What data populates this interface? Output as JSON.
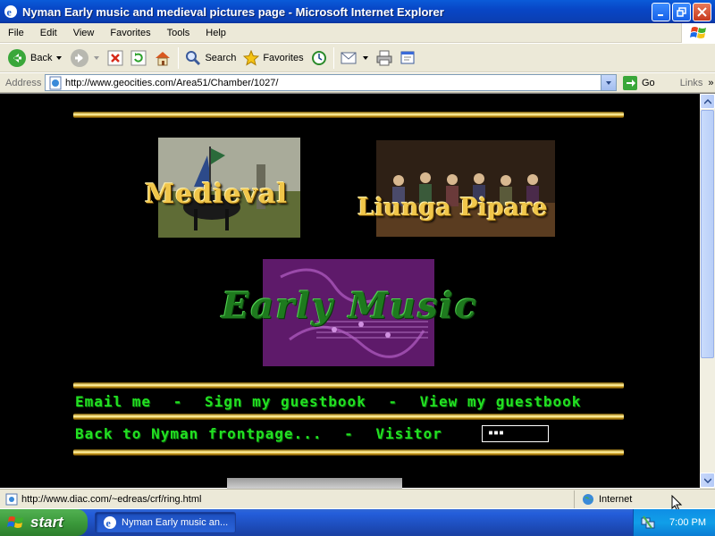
{
  "window": {
    "title": "Nyman Early music and medieval pictures page - Microsoft Internet Explorer"
  },
  "menu": [
    "File",
    "Edit",
    "View",
    "Favorites",
    "Tools",
    "Help"
  ],
  "toolbar": {
    "back_label": "Back",
    "search_label": "Search",
    "favorites_label": "Favorites"
  },
  "address": {
    "label": "Address",
    "url": "http://www.geocities.com/Area51/Chamber/1027/",
    "go_label": "Go",
    "links_label": "Links"
  },
  "page": {
    "medieval_title": "Medieval",
    "liunga_title": "Liunga Pipare",
    "early_music_title": "Early Music",
    "nav_line1": [
      "Email me",
      "Sign my guestbook",
      "View my guestbook"
    ],
    "nav_line2": [
      "Back to Nyman frontpage..."
    ],
    "visitor_label": "Visitor",
    "separator": "-",
    "counter_value": "▪▪▪"
  },
  "status": {
    "text": "http://www.diac.com/~edreas/crf/ring.html",
    "zone": "Internet"
  },
  "taskbar": {
    "start_label": "start",
    "task_label": "Nyman Early music an...",
    "clock": "7:00 PM"
  },
  "colors": {
    "title_blue": "#0a5bd9",
    "page_bg": "#000000",
    "nav_green": "#22e022",
    "gold": "#f0c64a"
  }
}
